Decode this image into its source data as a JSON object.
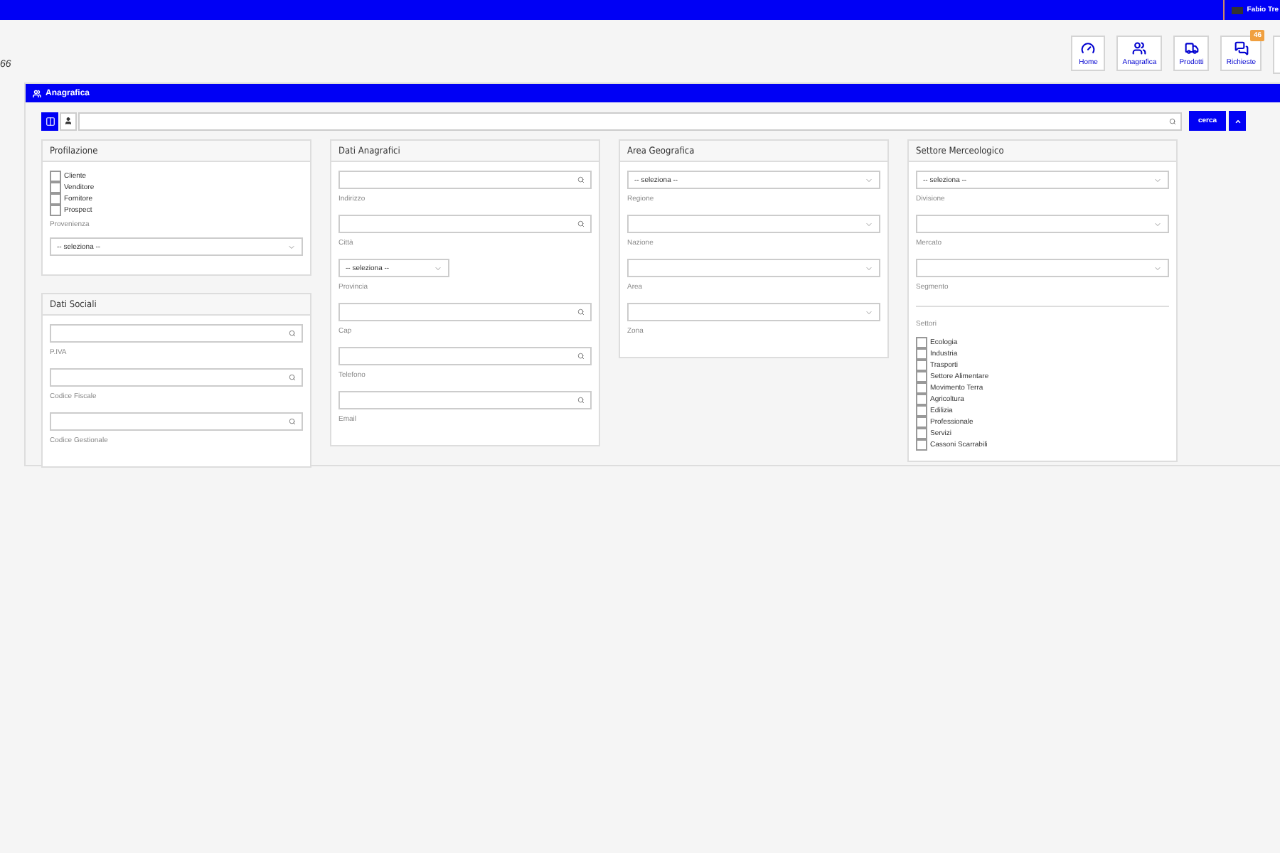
{
  "top_bar": {
    "user": "Fabio Tre"
  },
  "corner_text": "66",
  "nav": [
    {
      "kind": "gauge",
      "label": "Home"
    },
    {
      "kind": "users",
      "label": "Anagrafica"
    },
    {
      "kind": "truck",
      "label": "Prodotti"
    },
    {
      "kind": "chat",
      "label": "Richieste",
      "badge": "46"
    }
  ],
  "panel": {
    "title": "Anagrafica",
    "search_button": "cerca"
  },
  "columns": [
    [
      {
        "title": "Profilazione",
        "fields": [
          {
            "kind": "checklist",
            "items": [
              {
                "label": "Cliente",
                "checked": false
              },
              {
                "label": "Venditore",
                "checked": false
              },
              {
                "label": "Fornitore",
                "checked": false
              },
              {
                "label": "Prospect",
                "checked": false
              }
            ]
          },
          {
            "kind": "caption",
            "label": "Provenienza"
          },
          {
            "kind": "select",
            "value": "-- seleziona --"
          }
        ]
      },
      {
        "title": "Dati Sociali",
        "fields": [
          {
            "kind": "search",
            "label": "P.IVA"
          },
          {
            "kind": "search",
            "label": "Codice Fiscale"
          },
          {
            "kind": "search",
            "label": "Codice Gestionale"
          }
        ]
      }
    ],
    [
      {
        "title": "Dati Anagrafici",
        "fields": [
          {
            "kind": "search",
            "label": "Indirizzo"
          },
          {
            "kind": "search",
            "label": "Città"
          },
          {
            "kind": "select_small",
            "value": "-- seleziona --",
            "label": "Provincia"
          },
          {
            "kind": "search",
            "label": "Cap"
          },
          {
            "kind": "search",
            "label": "Telefono"
          },
          {
            "kind": "search",
            "label": "Email"
          }
        ]
      }
    ],
    [
      {
        "title": "Area Geografica",
        "fields": [
          {
            "kind": "select",
            "value": "-- seleziona --",
            "label": "Regione"
          },
          {
            "kind": "select",
            "label": "Nazione"
          },
          {
            "kind": "select",
            "label": "Area"
          },
          {
            "kind": "select",
            "label": "Zona"
          }
        ]
      }
    ],
    [
      {
        "title": "Settore Merceologico",
        "fields": [
          {
            "kind": "select",
            "value": "-- seleziona --",
            "label": "Divisione"
          },
          {
            "kind": "select",
            "label": "Mercato"
          },
          {
            "kind": "select",
            "label": "Segmento"
          },
          {
            "kind": "divider"
          },
          {
            "kind": "caption",
            "label": "Settori"
          },
          {
            "kind": "checklist",
            "items": [
              {
                "label": "Ecologia",
                "checked": false
              },
              {
                "label": "Industria",
                "checked": false
              },
              {
                "label": "Trasporti",
                "checked": false
              },
              {
                "label": "Settore Alimentare",
                "checked": false
              },
              {
                "label": "Movimento Terra",
                "checked": false
              },
              {
                "label": "Agricoltura",
                "checked": false
              },
              {
                "label": "Edilizia",
                "checked": false
              },
              {
                "label": "Professionale",
                "checked": false
              },
              {
                "label": "Servizi",
                "checked": false
              },
              {
                "label": "Cassoni Scarrabili",
                "checked": false
              }
            ]
          }
        ]
      }
    ]
  ]
}
